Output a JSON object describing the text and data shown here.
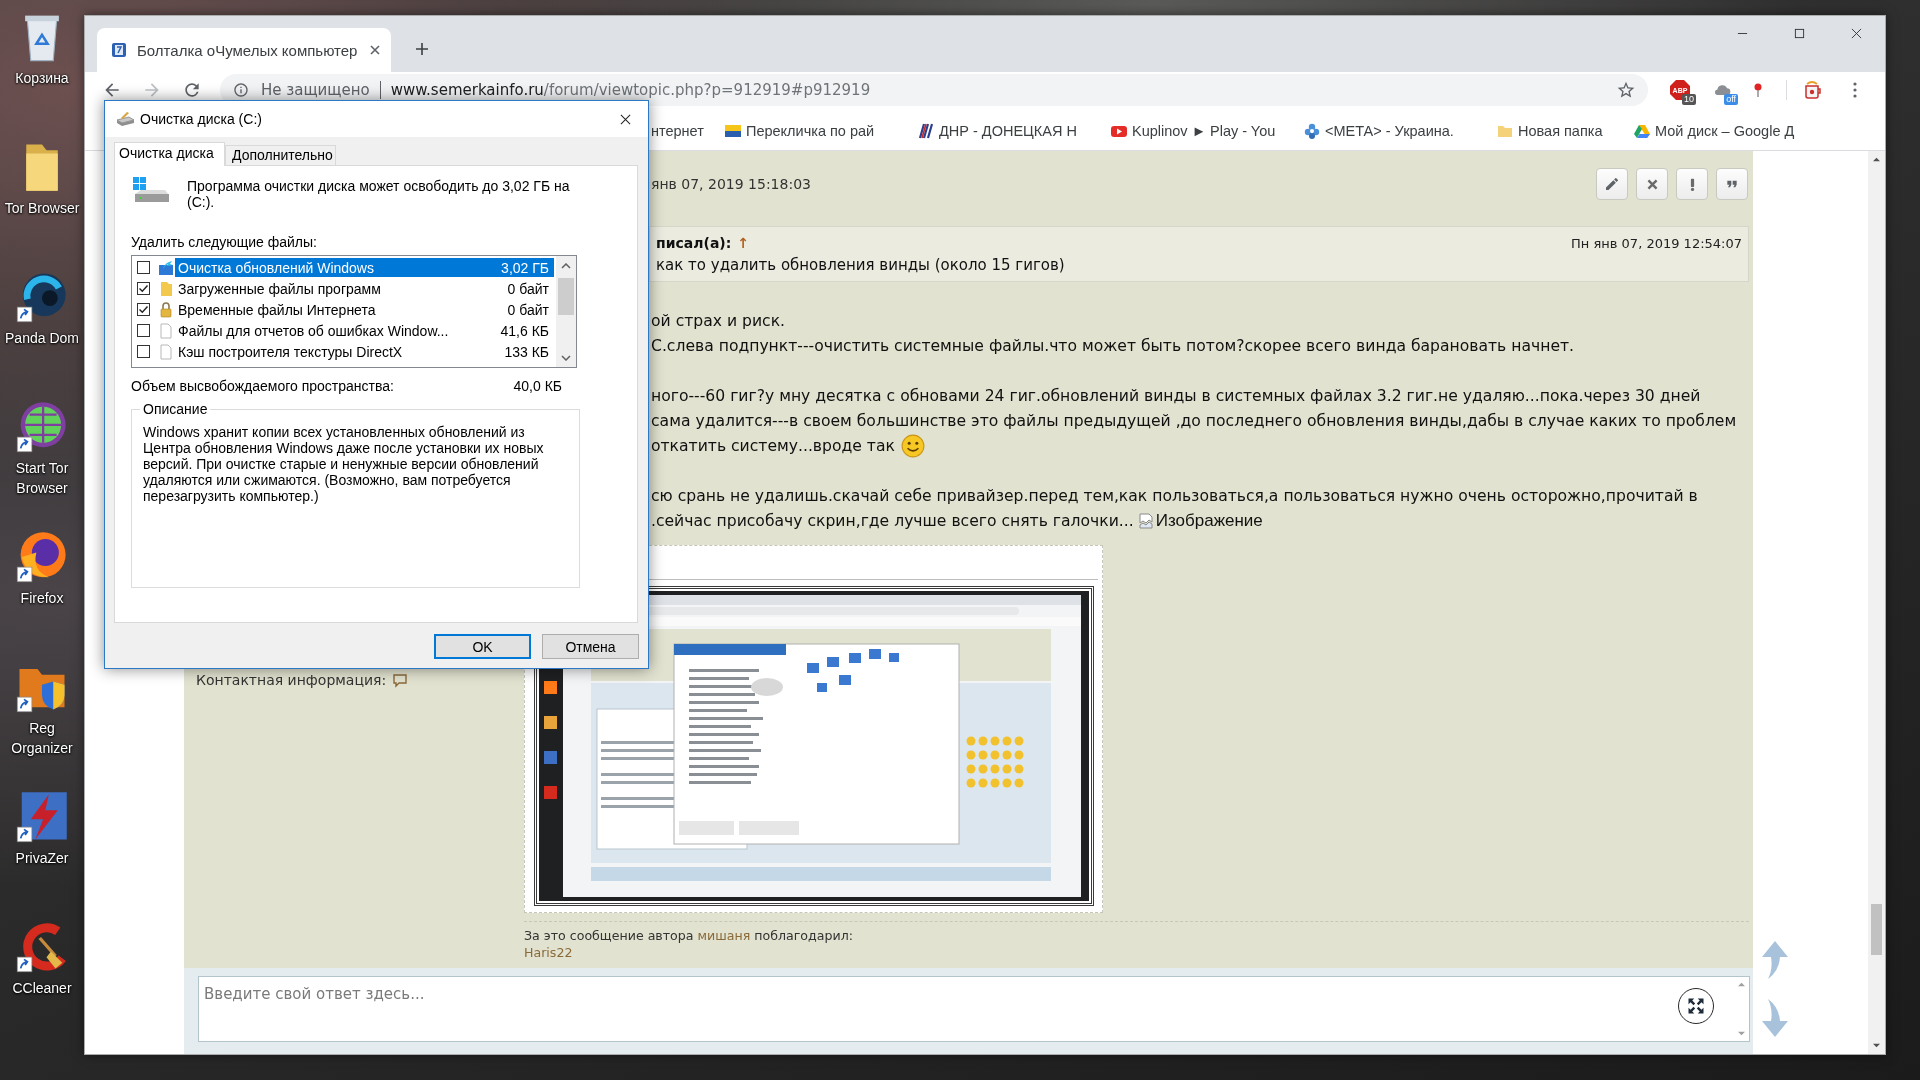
{
  "desktop_icons": [
    {
      "label": "Корзина"
    },
    {
      "label": "Tor Browser"
    },
    {
      "label": "Panda Dom"
    },
    {
      "label": "Start Tor Browser"
    },
    {
      "label": "Firefox"
    },
    {
      "label": "Reg Organizer"
    },
    {
      "label": "PrivaZer"
    },
    {
      "label": "CCleaner"
    }
  ],
  "browser": {
    "tabs": [
      {
        "title": "Болталка оЧумелых компьютер",
        "selected": true
      }
    ],
    "navigation": {
      "back": {
        "disabled": false
      },
      "forward": {
        "disabled": true
      }
    },
    "address": {
      "security": "Не защищено",
      "domain": "www.semerkainfo.ru",
      "path": "/forum/viewtopic.php?p=912919#p912919"
    },
    "extensions": [
      {
        "label": "ABP",
        "badge": "10"
      },
      {
        "badge": "off"
      }
    ],
    "bookmarks": [
      {
        "label": "нтернет"
      },
      {
        "label": "Перекличка по рай"
      },
      {
        "label": "ДНР - ДОНЕЦКАЯ Н"
      },
      {
        "label": "Kuplinov ► Play - You"
      },
      {
        "label": "<МЕТА> - Украина."
      },
      {
        "label": "Новая папка"
      },
      {
        "label": "Мой диск – Google Д"
      }
    ]
  },
  "post": {
    "date": "янв 07, 2019 15:18:03",
    "quote": {
      "header": "писал(а):",
      "arrow": "↑",
      "date": "Пн янв 07, 2019 12:54:07",
      "text": "как то удалить обновления винды (около 15 гигов)"
    },
    "paragraphs": [
      [
        {
          "text": "ой страх и риск.",
          "kind": "plain"
        },
        {
          "text": "С.слева подпункт---очистить системные файлы.что может быть потом?скорее всего винда барановать начнет.",
          "kind": "plain"
        }
      ],
      [
        {
          "text": "ного---60 гиг?у мну десятка с обновами 24 гиг.обновлений винды в системных файлах 3.2 гиг.не удаляю...пока.через 30 дней",
          "kind": "plain"
        },
        {
          "text": "сама удалится---в своем большинстве это файлы предыдущей ,до последнего обновления винды,дабы в случае каких то проблем",
          "kind": "plain"
        },
        {
          "text": "откатить систему...вроде так",
          "kind": "smiley"
        }
      ],
      [
        {
          "text": "сю срань не удалишь.скачай себе привайзер.перед тем,как пользоваться,а пользоваться нужно очень осторожно,прочитай в",
          "kind": "plain"
        },
        {
          "text": ".сейчас присобачу скрин,где лучше всего снять галочки...",
          "kind": "image",
          "alt": "Изображение"
        }
      ]
    ],
    "contact": "Контактная информация:",
    "thanks": {
      "before": "За это сообщение автора",
      "author": "мишаня",
      "after": "поблагодарил:",
      "users": [
        "Haris22"
      ]
    }
  },
  "reply": {
    "placeholder": "Введите свой ответ здесь..."
  },
  "dialog": {
    "title": "Очистка диска (C:)",
    "tabs": [
      {
        "label": "Очистка диска",
        "selected": true
      },
      {
        "label": "Дополнительно",
        "selected": false
      }
    ],
    "summary": "Программа очистки диска может освободить до 3,02 ГБ на (C:).",
    "list_label": "Удалить следующие файлы:",
    "files": [
      {
        "name": "Очистка обновлений Windows",
        "size": "3,02 ГБ",
        "checked": false,
        "selected": true
      },
      {
        "name": "Загруженные файлы программ",
        "size": "0 байт",
        "checked": true,
        "selected": false
      },
      {
        "name": "Временные файлы Интернета",
        "size": "0 байт",
        "checked": true,
        "selected": false
      },
      {
        "name": "Файлы для отчетов об ошибках Window...",
        "size": "41,6 КБ",
        "checked": false,
        "selected": false
      },
      {
        "name": "Кэш построителя текстуры DirectX",
        "size": "133 КБ",
        "checked": false,
        "selected": false
      }
    ],
    "space_label": "Объем высвобождаемого пространства:",
    "space_value": "40,0 КБ",
    "description": {
      "title": "Описание",
      "text": "Windows хранит копии всех установленных обновлений из Центра обновления Windows даже после установки их новых версий. При очистке старые и ненужные версии обновлений удаляются или сжимаются. (Возможно, вам потребуется перезагрузить компьютер.)"
    },
    "buttons": [
      {
        "label": "OK",
        "default": true
      },
      {
        "label": "Отмена",
        "default": false
      }
    ]
  }
}
